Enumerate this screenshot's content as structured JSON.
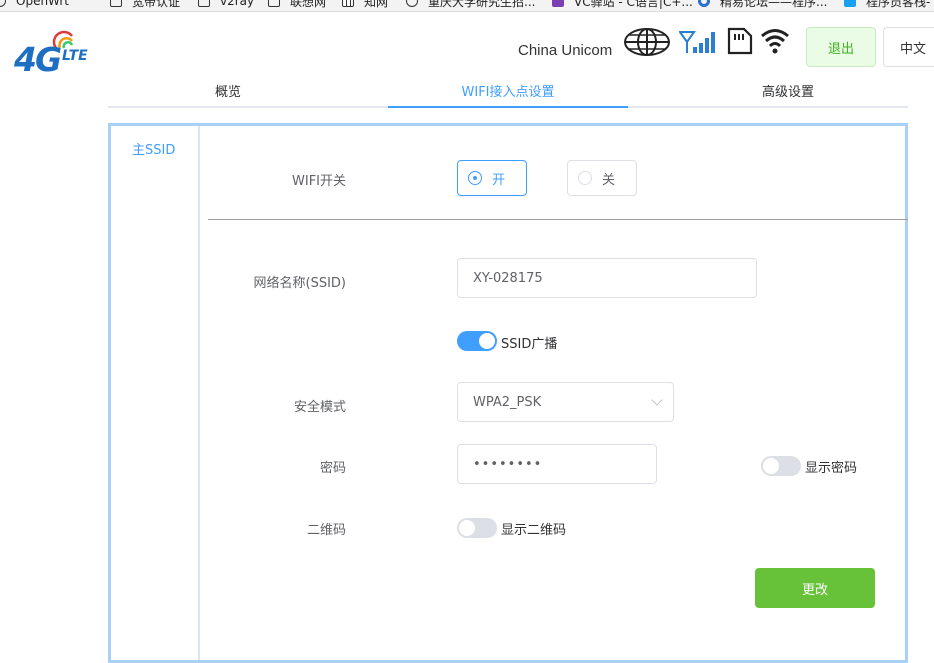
{
  "bookmarks": [
    "OpenWrt",
    "宽带认证",
    "v2ray",
    "联想网",
    "知网",
    "重庆大学研究生招...",
    "VC驿站 - C语言|C+...",
    "精易论坛——程序...",
    "程序员客栈-"
  ],
  "header": {
    "carrier": "China Unicom",
    "logout_label": "退出",
    "lang_label": "中文"
  },
  "logo": {
    "main": "4G",
    "sub": "LTE"
  },
  "tabs": [
    "概览",
    "WIFI接入点设置",
    "高级设置"
  ],
  "active_tab": "WIFI接入点设置",
  "sidebar": {
    "items": [
      "主SSID"
    ]
  },
  "form": {
    "wifi_switch_label": "WIFI开关",
    "wifi_on_label": "开",
    "wifi_off_label": "关",
    "ssid_label": "网络名称(SSID)",
    "ssid_value": "XY-028175",
    "ssid_broadcast_label": "SSID广播",
    "security_label": "安全模式",
    "security_value": "WPA2_PSK",
    "password_label": "密码",
    "password_value": "••••••••",
    "show_password_label": "显示密码",
    "qrcode_label": "二维码",
    "show_qrcode_label": "显示二维码",
    "submit_label": "更改"
  },
  "state": {
    "wifi_on": true,
    "ssid_broadcast": true,
    "show_password": false,
    "show_qrcode": false
  },
  "colors": {
    "primary": "#409eff",
    "success": "#67c23a",
    "logo_blue": "#1e6fc4"
  }
}
